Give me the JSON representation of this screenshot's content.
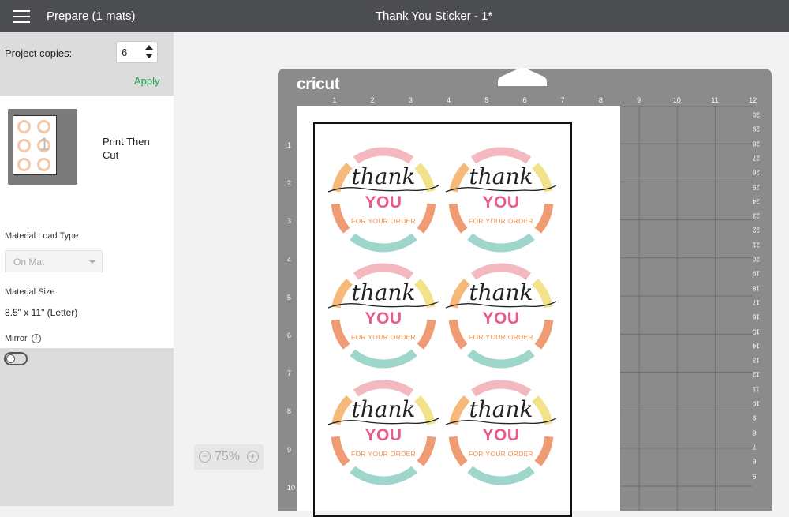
{
  "topbar": {
    "menu_icon": "hamburger-icon",
    "prepare_title": "Prepare (1 mats)",
    "project_title": "Thank You Sticker - 1*"
  },
  "sidebar": {
    "copies_label": "Project copies:",
    "copies_value": "6",
    "apply_label": "Apply",
    "mat_mode": "Print Then Cut",
    "mat_number": "1",
    "material_load_type_label": "Material Load Type",
    "material_load_type_value": "On Mat",
    "material_size_label": "Material Size",
    "material_size_value": "8.5\" x 11\" (Letter)",
    "mirror_label": "Mirror",
    "mirror_on": false
  },
  "mat": {
    "brand": "cricut",
    "top_ruler": [
      "1",
      "2",
      "3",
      "4",
      "5",
      "6",
      "7",
      "8",
      "9",
      "10",
      "11",
      "12"
    ],
    "left_ruler": [
      "1",
      "2",
      "3",
      "4",
      "5",
      "6",
      "7",
      "8",
      "9",
      "10"
    ],
    "right_ruler": [
      "30",
      "29",
      "28",
      "27",
      "26",
      "25",
      "24",
      "23",
      "22",
      "21",
      "20",
      "19",
      "18",
      "17",
      "16",
      "15",
      "14",
      "13",
      "12",
      "11",
      "10",
      "9",
      "8",
      "7",
      "6",
      "5"
    ]
  },
  "sticker": {
    "script_text": "thank",
    "big_text": "YOU",
    "sub_text": "FOR YOUR ORDER",
    "count": 6,
    "colors": {
      "pink": "#f4b8bf",
      "yellow": "#f2e38a",
      "orange": "#f6b979",
      "peach": "#ef9b73",
      "teal": "#9fd6cc",
      "you_pink": "#ea5a8f"
    }
  },
  "zoom": {
    "value": "75%",
    "minus": "−",
    "plus": "+"
  }
}
